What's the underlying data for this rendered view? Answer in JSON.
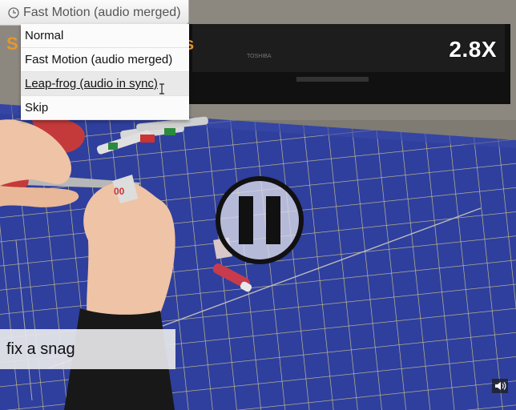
{
  "player": {
    "speed": "2.8X",
    "caption": "fix a snag"
  },
  "mode_select": {
    "selected": "Fast Motion (audio merged)",
    "options": [
      {
        "label": "Normal"
      },
      {
        "label": "Fast Motion (audio merged)"
      },
      {
        "label": "Leap-frog (audio in sync)"
      },
      {
        "label": "Skip"
      }
    ]
  },
  "colors": {
    "mat_blue": "#2f3f9d",
    "grid_line": "#c9c18f",
    "overlay_bg": "#e8e8ec"
  },
  "icons": {
    "mode": "clock-icon",
    "control": "pause-icon",
    "audio": "speaker-icon"
  }
}
